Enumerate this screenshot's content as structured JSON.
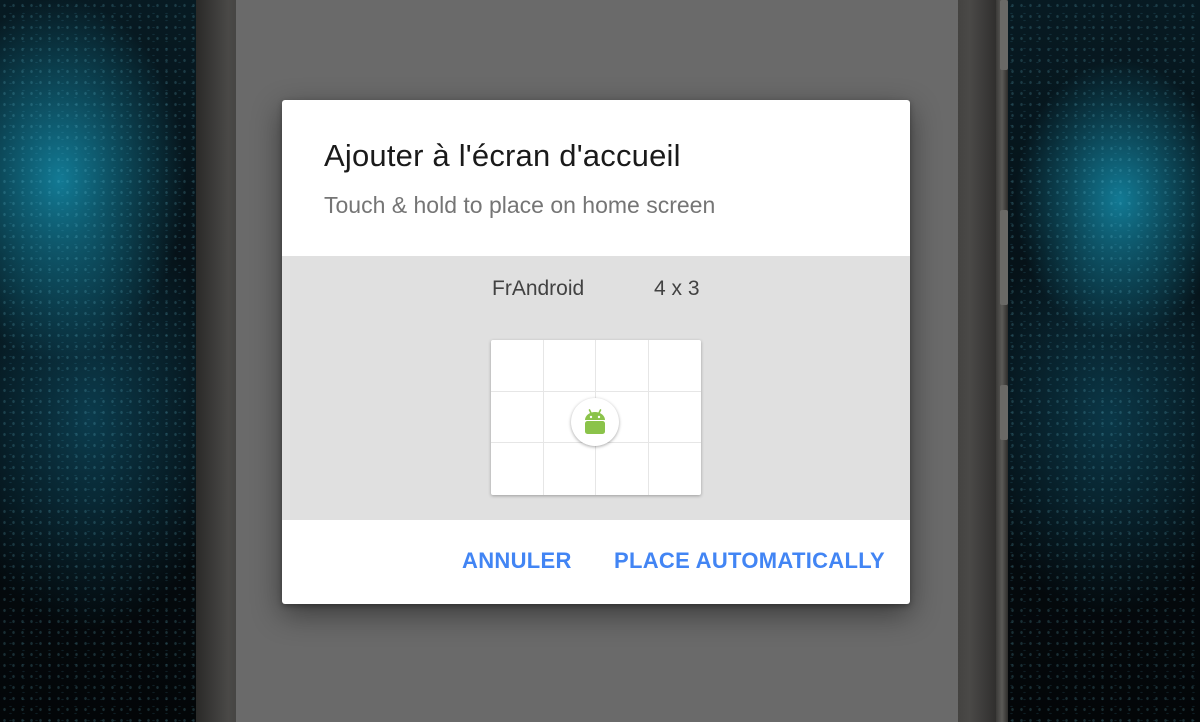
{
  "dialog": {
    "title": "Ajouter à l'écran d'accueil",
    "subtitle": "Touch & hold to place on home screen"
  },
  "widget": {
    "name": "FrAndroid",
    "size": "4 x 3",
    "grid_columns": 4,
    "grid_rows": 3,
    "icon": "android-robot-icon"
  },
  "actions": {
    "cancel_label": "ANNULER",
    "auto_label": "PLACE AUTOMATICALLY"
  },
  "colors": {
    "accent": "#4285f4",
    "android_green": "#8bc34a",
    "preview_bg": "#e0e0e0",
    "dialog_bg": "#ffffff",
    "scrim": "#6a6a6a"
  }
}
